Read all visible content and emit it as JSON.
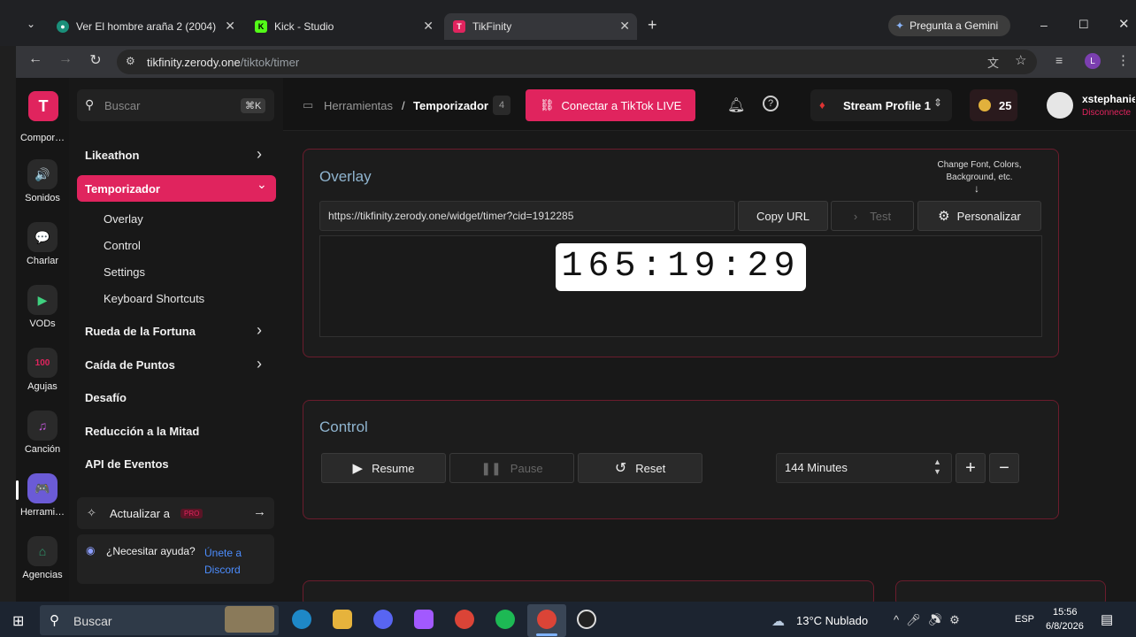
{
  "browser": {
    "tabs": [
      {
        "title": "Ver El hombre araña 2 (2004) O",
        "active": false
      },
      {
        "title": "Kick - Studio",
        "active": false
      },
      {
        "title": "TikFinity",
        "active": true
      }
    ],
    "gemini": "Pregunta a Gemini",
    "url_host": "tikfinity.zerody.one",
    "url_path": "/tiktok/timer",
    "profile_letter": "L"
  },
  "rail": {
    "items": [
      {
        "label": "Compor…",
        "icon": "share-icon"
      },
      {
        "label": "Sonidos",
        "icon": "speaker-icon"
      },
      {
        "label": "Charlar",
        "icon": "chat-icon"
      },
      {
        "label": "VODs",
        "icon": "video-icon"
      },
      {
        "label": "Agujas",
        "icon": "100-icon"
      },
      {
        "label": "Canción",
        "icon": "music-icon"
      },
      {
        "label": "Herrami…",
        "icon": "gamepad-icon"
      },
      {
        "label": "Agencias",
        "icon": "agency-icon"
      }
    ]
  },
  "search": {
    "placeholder": "Buscar",
    "shortcut": "⌘K"
  },
  "breadcrumb": {
    "parent": "Herramientas",
    "sep": "/",
    "current": "Temporizador",
    "count": "4"
  },
  "connect_button": "Conectar a TikTok LIVE",
  "stream_profile": "Stream Profile 1",
  "coins": "25",
  "user": {
    "name": "xstephanie",
    "status": "Disconnecte"
  },
  "sidebar": {
    "items": [
      {
        "label": "Likeathon",
        "chevron": "›"
      },
      {
        "label": "Temporizador",
        "chevron": "⌄",
        "active": true
      },
      {
        "label": "Rueda de la Fortuna",
        "chevron": "›"
      },
      {
        "label": "Caída de Puntos",
        "chevron": "›"
      },
      {
        "label": "Desafío"
      },
      {
        "label": "Reducción a la Mitad"
      },
      {
        "label": "API de Eventos"
      }
    ],
    "subitems": [
      "Overlay",
      "Control",
      "Settings",
      "Keyboard Shortcuts"
    ],
    "upgrade": {
      "label": "Actualizar a",
      "badge": "PRO"
    },
    "help": {
      "text": "¿Necesitar ayuda?",
      "link": "Únete a Discord"
    }
  },
  "overlay": {
    "title": "Overlay",
    "hint": "Change Font, Colors, Background, etc.",
    "widget_url": "https://tikfinity.zerody.one/widget/timer?cid=1912285",
    "copy_url": "Copy URL",
    "test": "Test",
    "personalize": "Personalizar",
    "timer": "165:19:29"
  },
  "control": {
    "title": "Control",
    "resume": "Resume",
    "pause": "Pause",
    "reset": "Reset",
    "minutes": "144 Minutes"
  },
  "taskbar": {
    "search": "Buscar",
    "weather": "13°C  Nublado",
    "lang": "ESP",
    "time": "15:56",
    "date": "6/8/2026"
  },
  "colors": {
    "accent": "#e0245e",
    "card_border": "#6b1c2d",
    "title_blue": "#8fb4cf"
  }
}
